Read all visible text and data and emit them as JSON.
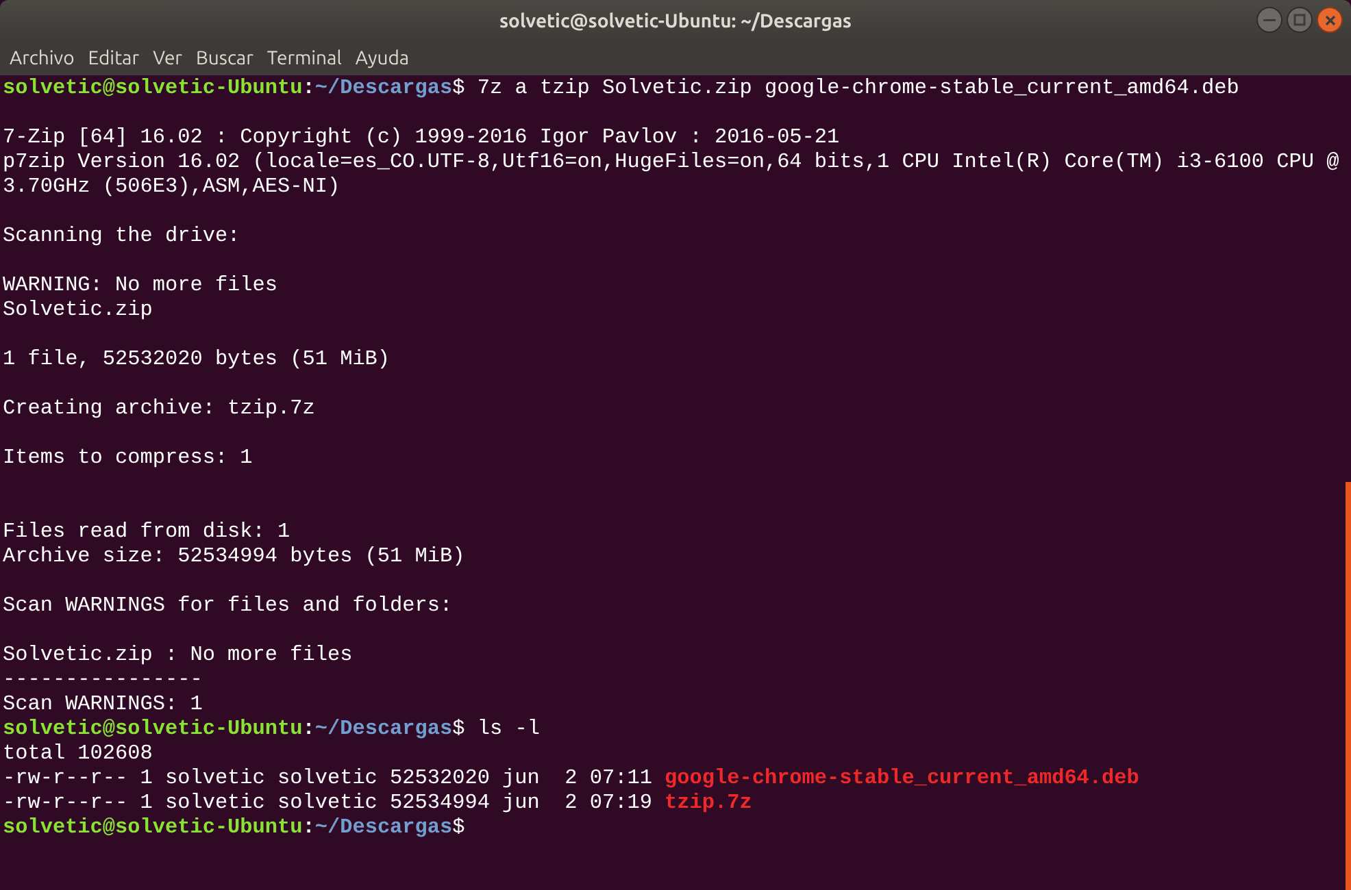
{
  "window": {
    "title": "solvetic@solvetic-Ubuntu: ~/Descargas"
  },
  "menu": [
    "Archivo",
    "Editar",
    "Ver",
    "Buscar",
    "Terminal",
    "Ayuda"
  ],
  "terminal": {
    "lines": [
      {
        "kind": "prompt",
        "user": "solvetic@solvetic-Ubuntu",
        "colon": ":",
        "path": "~/Descargas",
        "symbol": "$",
        "command": " 7z a tzip Solvetic.zip google-chrome-stable_current_amd64.deb"
      },
      {
        "kind": "blank"
      },
      {
        "kind": "text",
        "text": "7-Zip [64] 16.02 : Copyright (c) 1999-2016 Igor Pavlov : 2016-05-21"
      },
      {
        "kind": "text",
        "text": "p7zip Version 16.02 (locale=es_CO.UTF-8,Utf16=on,HugeFiles=on,64 bits,1 CPU Intel(R) Core(TM) i3-6100 CPU @"
      },
      {
        "kind": "text",
        "text": "3.70GHz (506E3),ASM,AES-NI)"
      },
      {
        "kind": "blank"
      },
      {
        "kind": "text",
        "text": "Scanning the drive:"
      },
      {
        "kind": "blank"
      },
      {
        "kind": "text",
        "text": "WARNING: No more files"
      },
      {
        "kind": "text",
        "text": "Solvetic.zip"
      },
      {
        "kind": "blank"
      },
      {
        "kind": "text",
        "text": "1 file, 52532020 bytes (51 MiB)"
      },
      {
        "kind": "blank"
      },
      {
        "kind": "text",
        "text": "Creating archive: tzip.7z"
      },
      {
        "kind": "blank"
      },
      {
        "kind": "text",
        "text": "Items to compress: 1"
      },
      {
        "kind": "blank"
      },
      {
        "kind": "blank"
      },
      {
        "kind": "text",
        "text": "Files read from disk: 1"
      },
      {
        "kind": "text",
        "text": "Archive size: 52534994 bytes (51 MiB)"
      },
      {
        "kind": "blank"
      },
      {
        "kind": "text",
        "text": "Scan WARNINGS for files and folders:"
      },
      {
        "kind": "blank"
      },
      {
        "kind": "text",
        "text": "Solvetic.zip : No more files"
      },
      {
        "kind": "text",
        "text": "----------------"
      },
      {
        "kind": "text",
        "text": "Scan WARNINGS: 1"
      },
      {
        "kind": "prompt",
        "user": "solvetic@solvetic-Ubuntu",
        "colon": ":",
        "path": "~/Descargas",
        "symbol": "$",
        "command": " ls -l"
      },
      {
        "kind": "text",
        "text": "total 102608"
      },
      {
        "kind": "listing",
        "info": "-rw-r--r-- 1 solvetic solvetic 52532020 jun  2 07:11 ",
        "file": "google-chrome-stable_current_amd64.deb"
      },
      {
        "kind": "listing",
        "info": "-rw-r--r-- 1 solvetic solvetic 52534994 jun  2 07:19 ",
        "file": "tzip.7z"
      },
      {
        "kind": "prompt",
        "user": "solvetic@solvetic-Ubuntu",
        "colon": ":",
        "path": "~/Descargas",
        "symbol": "$"
      }
    ]
  }
}
